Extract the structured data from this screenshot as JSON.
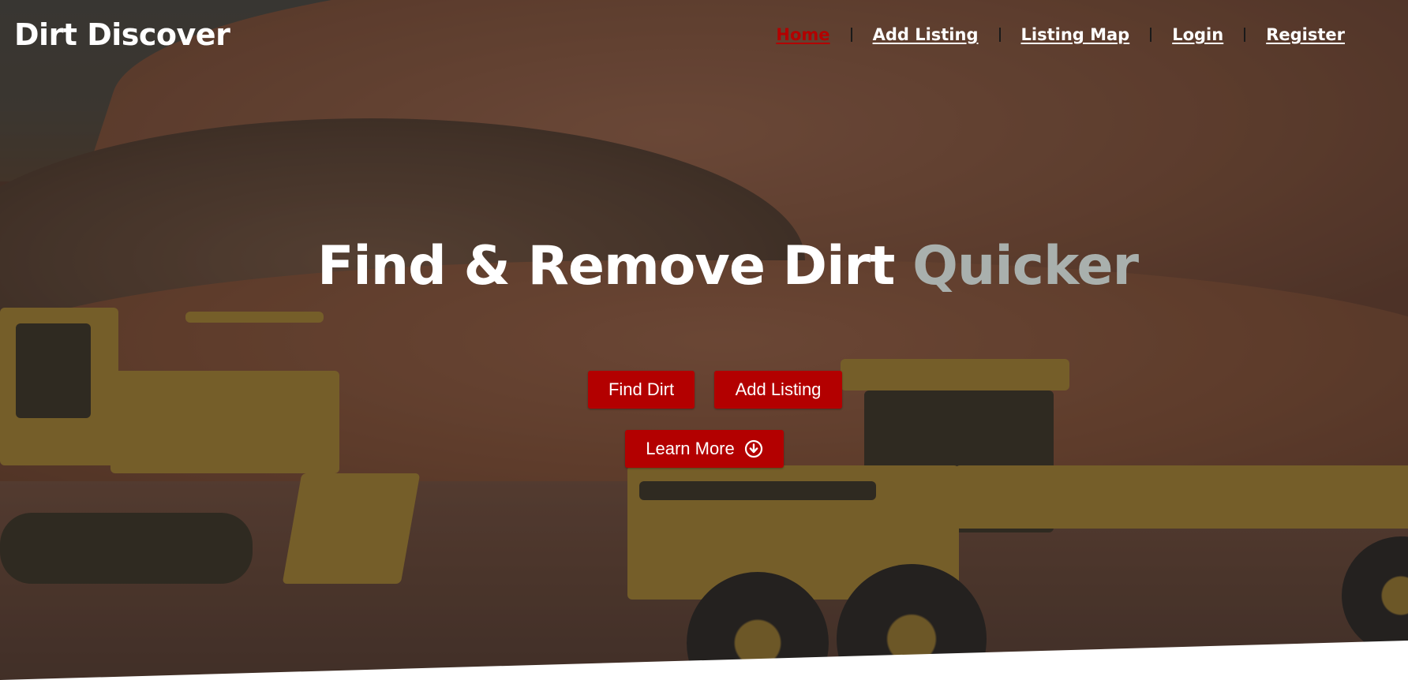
{
  "header": {
    "brand": "Dirt Discover",
    "nav": [
      {
        "label": "Home",
        "active": true
      },
      {
        "label": "Add Listing",
        "active": false
      },
      {
        "label": "Listing Map",
        "active": false
      },
      {
        "label": "Login",
        "active": false
      },
      {
        "label": "Register",
        "active": false
      }
    ]
  },
  "hero": {
    "headline_main": "Find & Remove Dirt",
    "headline_accent": "Quicker",
    "buttons": {
      "find_dirt": "Find Dirt",
      "add_listing": "Add Listing",
      "learn_more": "Learn More",
      "learn_more_icon": "arrow-down-circle-icon"
    }
  },
  "colors": {
    "accent_red": "#b30000",
    "headline_accent": "#a9b0ad",
    "text": "#ffffff"
  }
}
